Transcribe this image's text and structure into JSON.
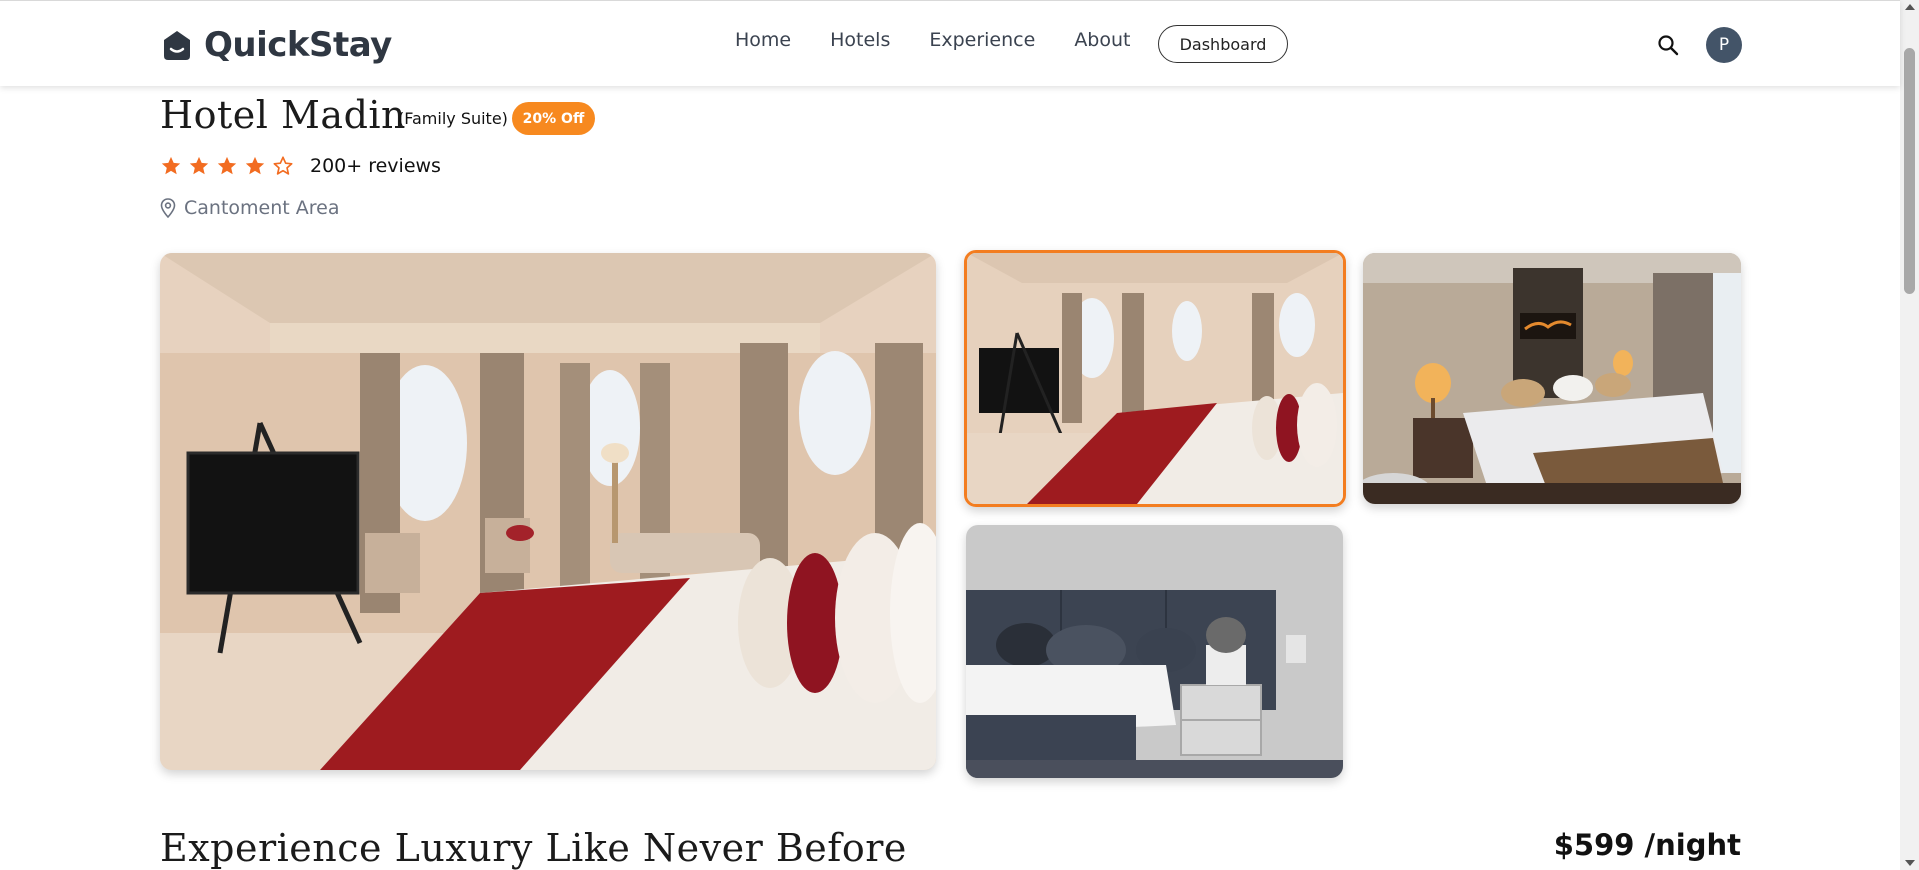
{
  "brand": {
    "name": "QuickStay",
    "icon": "house-logo-icon"
  },
  "nav": {
    "links": [
      "Home",
      "Hotels",
      "Experience",
      "About"
    ],
    "dashboard_label": "Dashboard",
    "avatar_initial": "P",
    "search_icon": "search-icon"
  },
  "hotel": {
    "name": "Hotel Madin",
    "room_type": "(Family Suite)",
    "discount_label": "20% Off",
    "rating": {
      "value": 4,
      "max": 5
    },
    "reviews_label": "200+ reviews",
    "location": "Cantoment Area"
  },
  "gallery": {
    "selected_index": 0,
    "images": [
      "main-room-photo",
      "thumb-room-photo-1",
      "thumb-room-photo-2",
      "thumb-room-photo-3"
    ]
  },
  "section": {
    "headline": "Experience Luxury Like Never Before",
    "price": "$599 /night"
  },
  "colors": {
    "accent": "#f37d20",
    "badge": "#f7891f",
    "avatar_bg": "#435468",
    "text_muted": "#6b7280"
  }
}
